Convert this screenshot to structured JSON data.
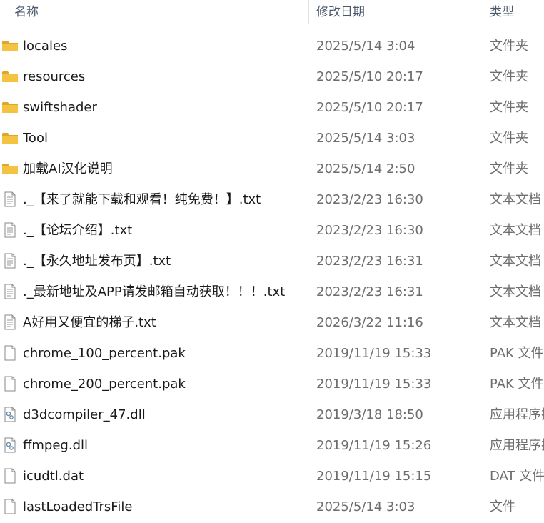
{
  "header": {
    "name_label": "名称",
    "date_label": "修改日期",
    "type_label": "类型"
  },
  "rows": [
    {
      "name": "locales",
      "date": "2025/5/14 3:04",
      "type": "文件夹",
      "icon": "folder-icon"
    },
    {
      "name": "resources",
      "date": "2025/5/10 20:17",
      "type": "文件夹",
      "icon": "folder-icon"
    },
    {
      "name": "swiftshader",
      "date": "2025/5/10 20:17",
      "type": "文件夹",
      "icon": "folder-icon"
    },
    {
      "name": "Tool",
      "date": "2025/5/14 3:03",
      "type": "文件夹",
      "icon": "folder-icon"
    },
    {
      "name": "加载AI汉化说明",
      "date": "2025/5/14 2:50",
      "type": "文件夹",
      "icon": "folder-icon"
    },
    {
      "name": "._【来了就能下载和观看！纯免费！】.txt",
      "date": "2023/2/23 16:30",
      "type": "文本文档",
      "icon": "text-file-icon"
    },
    {
      "name": "._【论坛介绍】.txt",
      "date": "2023/2/23 16:30",
      "type": "文本文档",
      "icon": "text-file-icon"
    },
    {
      "name": "._【永久地址发布页】.txt",
      "date": "2023/2/23 16:31",
      "type": "文本文档",
      "icon": "text-file-icon"
    },
    {
      "name": "._最新地址及APP请发邮箱自动获取！！！.txt",
      "date": "2023/2/23 16:31",
      "type": "文本文档",
      "icon": "text-file-icon"
    },
    {
      "name": "A好用又便宜的梯子.txt",
      "date": "2026/3/22 11:16",
      "type": "文本文档",
      "icon": "text-file-icon"
    },
    {
      "name": "chrome_100_percent.pak",
      "date": "2019/11/19 15:33",
      "type": "PAK 文件",
      "icon": "blank-file-icon"
    },
    {
      "name": "chrome_200_percent.pak",
      "date": "2019/11/19 15:33",
      "type": "PAK 文件",
      "icon": "blank-file-icon"
    },
    {
      "name": "d3dcompiler_47.dll",
      "date": "2019/3/18 18:50",
      "type": "应用程序扩",
      "icon": "dll-file-icon"
    },
    {
      "name": "ffmpeg.dll",
      "date": "2019/11/19 15:26",
      "type": "应用程序扩",
      "icon": "dll-file-icon"
    },
    {
      "name": "icudtl.dat",
      "date": "2019/11/19 15:15",
      "type": "DAT 文件",
      "icon": "blank-file-icon"
    },
    {
      "name": "lastLoadedTrsFile",
      "date": "2025/5/14 3:03",
      "type": "文件",
      "icon": "blank-file-icon"
    }
  ],
  "colors": {
    "folder": "#f5c342",
    "folder_dark": "#e0a62a",
    "file_stroke": "#8a8a8a",
    "gear": "#6a8fb0"
  }
}
